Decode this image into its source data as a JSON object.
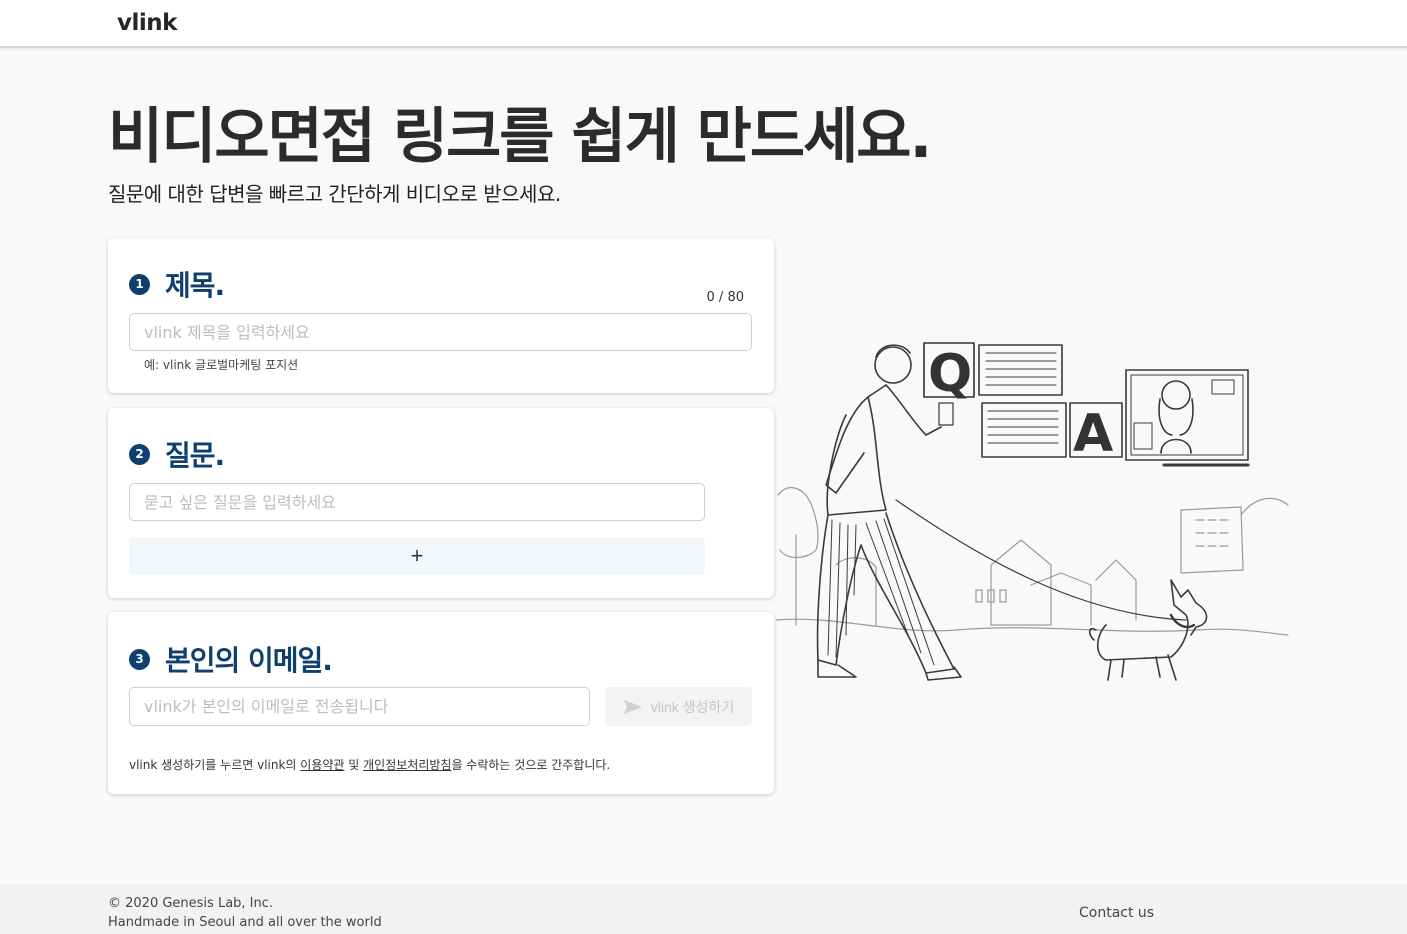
{
  "header": {
    "logo": "vlink"
  },
  "hero": {
    "title": "비디오면접 링크를 쉽게 만드세요.",
    "subtitle": "질문에 대한 답변을 빠르고 간단하게 비디오로 받으세요."
  },
  "step1": {
    "number": "1",
    "title": "제목.",
    "counter": "0 / 80",
    "placeholder": "vlink 제목을 입력하세요",
    "hint": "예: vlink 글로벌마케팅 포지션"
  },
  "step2": {
    "number": "2",
    "title": "질문.",
    "placeholder": "묻고 싶은 질문을 입력하세요",
    "add_label": "+"
  },
  "step3": {
    "number": "3",
    "title": "본인의 이메일.",
    "placeholder": "vlink가 본인의 이메일로 전송됩니다",
    "create_label": "vlink 생성하기",
    "terms_prefix": "vlink 생성하기를 누르면 vlink의 ",
    "terms_link": "이용약관",
    "terms_and": " 및 ",
    "privacy_link": "개인정보처리방침",
    "terms_suffix": "을 수락하는 것으로 간주합니다."
  },
  "illustration": {
    "q_letter": "Q",
    "a_letter": "A"
  },
  "footer": {
    "copyright": "© 2020 Genesis Lab, Inc.",
    "tagline": "Handmade in Seoul and all over the world",
    "contact": "Contact us"
  },
  "colors": {
    "accent": "#0f3f6e",
    "background": "#f9f9f9"
  }
}
